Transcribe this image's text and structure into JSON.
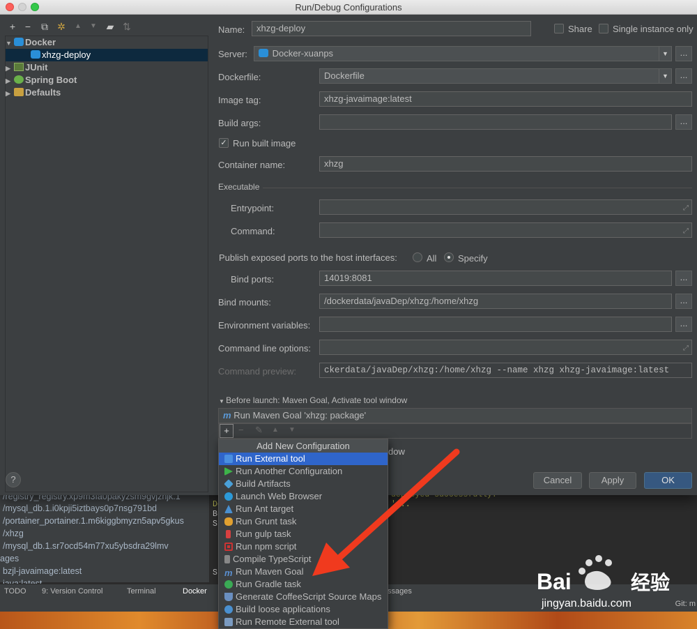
{
  "window": {
    "title": "Run/Debug Configurations"
  },
  "tree": {
    "items": [
      {
        "label": "Docker"
      },
      {
        "label": "xhzg-deploy"
      },
      {
        "label": "JUnit"
      },
      {
        "label": "Spring Boot"
      },
      {
        "label": "Defaults"
      }
    ]
  },
  "form": {
    "name_label": "Name:",
    "name_value": "xhzg-deploy",
    "share_label": "Share",
    "single_label": "Single instance only",
    "server_label": "Server:",
    "server_value": "Docker-xuanps",
    "dockerfile_label": "Dockerfile:",
    "dockerfile_value": "Dockerfile",
    "imagetag_label": "Image tag:",
    "imagetag_value": "xhzg-javaimage:latest",
    "buildargs_label": "Build args:",
    "runbuilt_label": "Run built image",
    "container_label": "Container name:",
    "container_value": "xhzg",
    "executable_label": "Executable",
    "entrypoint_label": "Entrypoint:",
    "command_label": "Command:",
    "publish_label": "Publish exposed ports to the host interfaces:",
    "all_label": "All",
    "specify_label": "Specify",
    "bindports_label": "Bind ports:",
    "bindports_value": "14019:8081",
    "bindmounts_label": "Bind mounts:",
    "bindmounts_value": "/dockerdata/javaDep/xhzg:/home/xhzg",
    "envvars_label": "Environment variables:",
    "cmdline_label": "Command line options:",
    "cmdpreview_label": "Command preview:",
    "cmdpreview_value": "ckerdata/javaDep/xhzg:/home/xhzg --name xhzg xhzg-javaimage:latest",
    "beforelaunch_label": "Before launch: Maven Goal, Activate tool window",
    "maven_goal_item": "Run Maven Goal 'xhzg: package'",
    "ellipsis": "...",
    "show_partial": "dow"
  },
  "buttons": {
    "cancel": "Cancel",
    "apply": "Apply",
    "ok": "OK",
    "help": "?"
  },
  "popup": {
    "title": "Add New Configuration",
    "items": [
      {
        "label": "Run External tool",
        "color": "#4a8fe0"
      },
      {
        "label": "Run Another Configuration",
        "color": "#3db34a"
      },
      {
        "label": "Build Artifacts",
        "color": "#4aa0d8"
      },
      {
        "label": "Launch Web Browser",
        "color": "#2c9ad8"
      },
      {
        "label": "Run Ant target",
        "color": "#4a90d0"
      },
      {
        "label": "Run Grunt task",
        "color": "#e0a030"
      },
      {
        "label": "Run gulp task",
        "color": "#d84040"
      },
      {
        "label": "Run npm script",
        "color": "#cc3333"
      },
      {
        "label": "Compile TypeScript",
        "color": "#888888"
      },
      {
        "label": "Run Maven Goal",
        "color": "#5a8fd0"
      },
      {
        "label": "Run Gradle task",
        "color": "#3aaa55"
      },
      {
        "label": "Generate CoffeeScript Source Maps",
        "color": "#6a8fc0"
      },
      {
        "label": "Build loose applications",
        "color": "#4a90d0"
      },
      {
        "label": "Run Remote External tool",
        "color": "#7a9ac0"
      }
    ]
  },
  "background": {
    "left_lines": [
      "/registry_registry.xp9m3fa0pakyzsm9gvjznjk.1",
      "/mysql_db.1.i0kpji5iztbays0p7nsg791bd",
      "/portainer_portainer.1.m6kiggbmyzn5apv5gkus",
      "/xhzg",
      "/mysql_db.1.sr7ocd54m77xu5ybsdra29lmv",
      "ages",
      "bzjl-javaimage:latest",
      "java:latest"
    ],
    "log_lines": [
      "deployed successfully.",
      "'...",
      "De",
      "Bu",
      "St",
      "St"
    ],
    "tabs": [
      "TODO",
      "9: Version Control",
      "Terminal",
      "Docker",
      "ssages"
    ],
    "status": [
      "Git: m"
    ]
  },
  "watermark": {
    "brand": "Bai",
    "brand2": "经验",
    "url": "jingyan.baidu.com"
  }
}
